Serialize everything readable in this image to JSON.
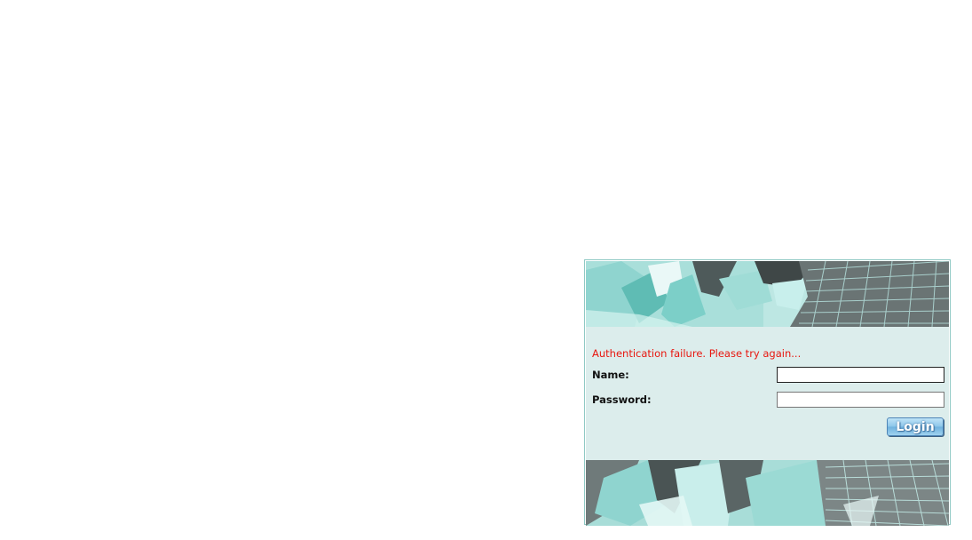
{
  "login": {
    "error_message": "Authentication failure. Please try again...",
    "name_label": "Name:",
    "name_value": "",
    "password_label": "Password:",
    "password_value": "",
    "login_button": "Login"
  },
  "colors": {
    "panel_border": "#8fc9c4",
    "form_background": "#dcedec",
    "error_text": "#e8170f",
    "button_blue": "#8cc6ea"
  }
}
